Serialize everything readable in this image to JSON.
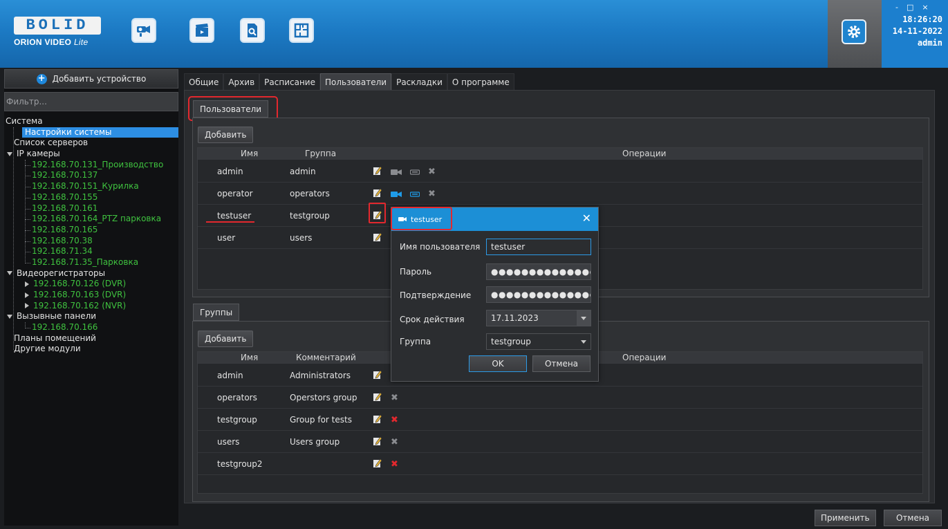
{
  "header": {
    "logo_main": "BOLID",
    "logo_sub_bold": "ORION VIDEO",
    "logo_sub_italic": "Lite",
    "buttons": [
      "camera-icon",
      "clapperboard-icon",
      "document-search-icon",
      "floor-plan-icon"
    ],
    "window_controls": [
      "-",
      "□",
      "×"
    ],
    "time": "18:26:20",
    "date": "14-11-2022",
    "user": "admin"
  },
  "left": {
    "add_device": "Добавить устройство",
    "filter_placeholder": "Фильтр...",
    "tree": [
      {
        "label": "Система",
        "level": 0,
        "color": "white"
      },
      {
        "label": "Настройки системы",
        "level": 1,
        "color": "white",
        "selected": true
      },
      {
        "label": "Список серверов",
        "level": 1,
        "color": "white"
      },
      {
        "label": "IP камеры",
        "level": 0,
        "color": "white",
        "expand": "down"
      },
      {
        "label": "192.168.70.131_Производство",
        "level": 2,
        "color": "green"
      },
      {
        "label": "192.168.70.137",
        "level": 2,
        "color": "green"
      },
      {
        "label": "192.168.70.151_Курилка",
        "level": 2,
        "color": "green"
      },
      {
        "label": "192.168.70.155",
        "level": 2,
        "color": "green"
      },
      {
        "label": "192.168.70.161",
        "level": 2,
        "color": "green"
      },
      {
        "label": "192.168.70.164_PTZ парковка",
        "level": 2,
        "color": "green"
      },
      {
        "label": "192.168.70.165",
        "level": 2,
        "color": "green"
      },
      {
        "label": "192.168.70.38",
        "level": 2,
        "color": "green"
      },
      {
        "label": "192.168.71.34",
        "level": 2,
        "color": "green"
      },
      {
        "label": "192.168.71.35_Парковка",
        "level": 2,
        "color": "green"
      },
      {
        "label": "Видеорегистраторы",
        "level": 0,
        "color": "white",
        "expand": "down"
      },
      {
        "label": "192.168.70.126 (DVR)",
        "level": 2,
        "color": "green",
        "expand": "right"
      },
      {
        "label": "192.168.70.163 (DVR)",
        "level": 2,
        "color": "green",
        "expand": "right"
      },
      {
        "label": "192.168.70.162 (NVR)",
        "level": 2,
        "color": "green",
        "expand": "right"
      },
      {
        "label": "Вызывные панели",
        "level": 0,
        "color": "white",
        "expand": "down"
      },
      {
        "label": "192.168.70.166",
        "level": 2,
        "color": "green"
      },
      {
        "label": "Планы помещений",
        "level": 1,
        "color": "white"
      },
      {
        "label": "Другие модули",
        "level": 1,
        "color": "white"
      }
    ]
  },
  "tabs": [
    "Общие",
    "Архив",
    "Расписание",
    "Пользователи",
    "Раскладки",
    "О программе"
  ],
  "users_section": {
    "subtab": "Пользователи",
    "add_button": "Добавить",
    "col_name": "Имя",
    "col_group": "Группа",
    "col_ops": "Операции",
    "rows": [
      {
        "name": "admin",
        "group": "admin",
        "cam_active": false,
        "x_red": false
      },
      {
        "name": "operator",
        "group": "operators",
        "cam_active": true,
        "x_red": false
      },
      {
        "name": "testuser",
        "group": "testgroup",
        "cam_active": false,
        "x_red": false
      },
      {
        "name": "user",
        "group": "users",
        "cam_active": false,
        "x_red": false
      }
    ]
  },
  "groups_section": {
    "subtab": "Группы",
    "add_button": "Добавить",
    "col_name": "Имя",
    "col_comment": "Комментарий",
    "col_ops": "Операции",
    "rows": [
      {
        "name": "admin",
        "comment": "Administrators",
        "x_red": false
      },
      {
        "name": "operators",
        "comment": "Operstors group",
        "x_red": false
      },
      {
        "name": "testgroup",
        "comment": "Group for tests",
        "x_red": true
      },
      {
        "name": "users",
        "comment": "Users group",
        "x_red": false
      },
      {
        "name": "testgroup2",
        "comment": "",
        "x_red": true
      }
    ]
  },
  "dialog": {
    "title": "testuser",
    "label_username": "Имя пользователя",
    "username": "testuser",
    "label_password": "Пароль",
    "password_mask": "●●●●●●●●●●●●●●●●",
    "label_confirm": "Подтверждение",
    "confirm_mask": "●●●●●●●●●●●●●●●●",
    "label_expiry": "Срок действия",
    "expiry": "17.11.2023",
    "label_group": "Группа",
    "group": "testgroup",
    "ok": "OK",
    "cancel": "Отмена"
  },
  "footer": {
    "apply": "Применить",
    "cancel": "Отмена"
  },
  "colors": {
    "accent": "#1c8fd6",
    "green_text": "#3fc23f",
    "highlight_red": "#e3282e",
    "cam_blue": "#1e9be8"
  }
}
